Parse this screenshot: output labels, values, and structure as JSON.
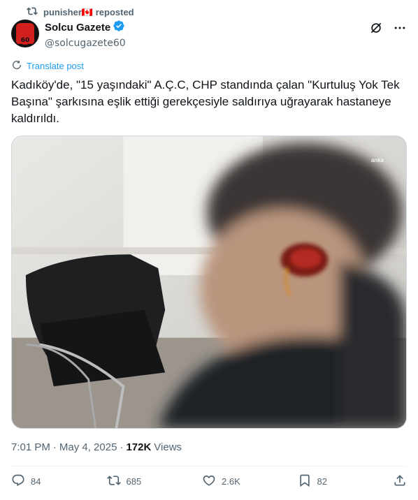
{
  "repost": {
    "user": "punisher🇨🇦",
    "label": "reposted"
  },
  "author": {
    "display_name": "Solcu Gazete",
    "handle": "@solcugazete60",
    "verified": true
  },
  "translate_label": "Translate post",
  "post": {
    "text": "Kadıköy'de, \"15 yaşındaki\" A.Ç.C, CHP standında çalan \"Kurtuluş Yok Tek Başına\" şarkısına eşlik ettiği gerekçesiyle saldırıya uğrayarak hastaneye kaldırıldı."
  },
  "media": {
    "watermark": "anka"
  },
  "meta": {
    "time": "7:01 PM",
    "separator": "·",
    "date": "May 4, 2025",
    "separator2": "·",
    "views_count": "172K",
    "views_label": "Views"
  },
  "actions": {
    "replies": "84",
    "reposts": "685",
    "likes": "2.6K",
    "bookmarks": "82"
  },
  "colors": {
    "accent": "#1d9bf0",
    "muted": "#536471",
    "text": "#0f1419"
  },
  "icons": [
    "repost-icon",
    "verified-badge-icon",
    "grok-icon",
    "more-icon",
    "translate-icon",
    "reply-icon",
    "retweet-icon",
    "like-icon",
    "bookmark-icon",
    "share-icon"
  ]
}
